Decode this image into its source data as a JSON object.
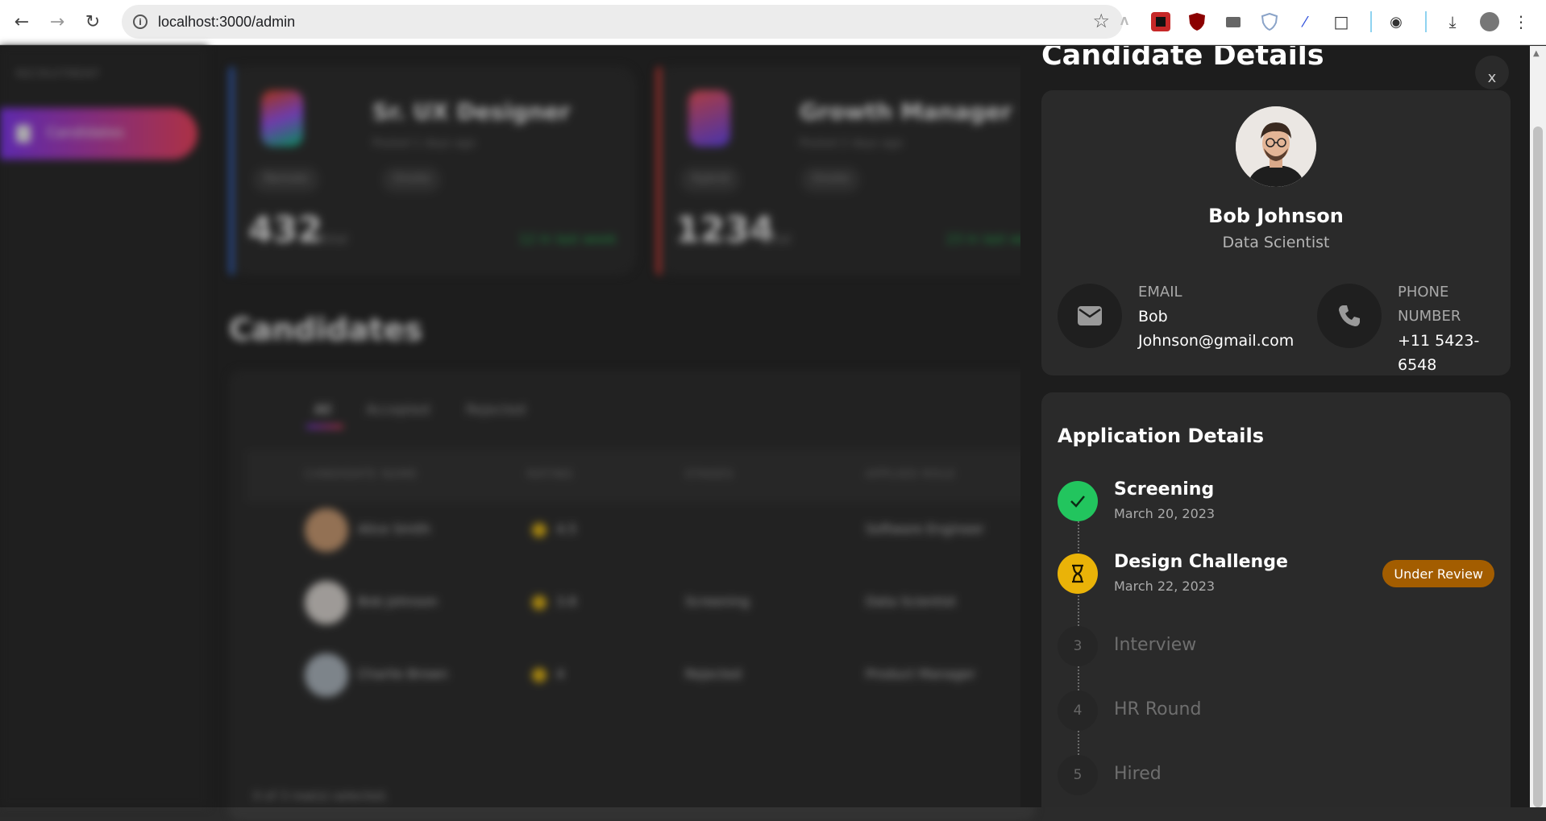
{
  "browser": {
    "url": "localhost:3000/admin"
  },
  "background": {
    "sidebar": {
      "section_label": "RECRUITMENT",
      "active_item": "Candidates"
    },
    "job_cards": [
      {
        "title": "Sr. UX Designer",
        "posted": "Posted 1 days ago",
        "tags": [
          "Remote",
          "Onsite"
        ],
        "count": "432",
        "unit": "Total",
        "trend": "12 in last week",
        "accent": "#3b6fd6"
      },
      {
        "title": "Growth Manager",
        "posted": "Posted 2 days ago",
        "tags": [
          "Hybrid",
          "Onsite"
        ],
        "count": "1234",
        "unit": "Total",
        "trend": "23 in last week",
        "accent": "#e0433d"
      }
    ],
    "candidates_title": "Candidates",
    "tabs": [
      "All",
      "Accepted",
      "Rejected"
    ],
    "columns": [
      "CANDIDATE NAME",
      "RATING",
      "STAGES",
      "APPLIED ROLE"
    ],
    "rows": [
      {
        "name": "Alice Smith",
        "rating": "4.5",
        "stage": "",
        "role": "Software Engineer"
      },
      {
        "name": "Bob Johnson",
        "rating": "3.8",
        "stage": "Screening",
        "role": "Data Scientist"
      },
      {
        "name": "Charlie Brown",
        "rating": "4",
        "stage": "Rejected",
        "role": "Product Manager"
      }
    ],
    "footer": "0 of 3 row(s) selected."
  },
  "drawer": {
    "title": "Candidate Details",
    "close_label": "x",
    "candidate": {
      "name": "Bob Johnson",
      "role": "Data Scientist",
      "email_label": "EMAIL",
      "email_line1": "Bob",
      "email_line2": "Johnson@gmail.com",
      "phone_label_line1": "PHONE",
      "phone_label_line2": "NUMBER",
      "phone": "+11 5423-6548"
    },
    "application": {
      "title": "Application Details",
      "steps": [
        {
          "name": "Screening",
          "date": "March 20, 2023",
          "status": "complete"
        },
        {
          "name": "Design Challenge",
          "date": "March 22, 2023",
          "status": "in-progress",
          "badge": "Under Review"
        },
        {
          "number": "3",
          "name": "Interview",
          "status": "pending"
        },
        {
          "number": "4",
          "name": "HR Round",
          "status": "pending"
        },
        {
          "number": "5",
          "name": "Hired",
          "status": "pending"
        }
      ]
    }
  },
  "colors": {
    "complete": "#22c55e",
    "in_progress": "#eab308",
    "badge": "#a35d00",
    "accent_gradient_start": "#8b3dff",
    "accent_gradient_end": "#ff4a66"
  }
}
